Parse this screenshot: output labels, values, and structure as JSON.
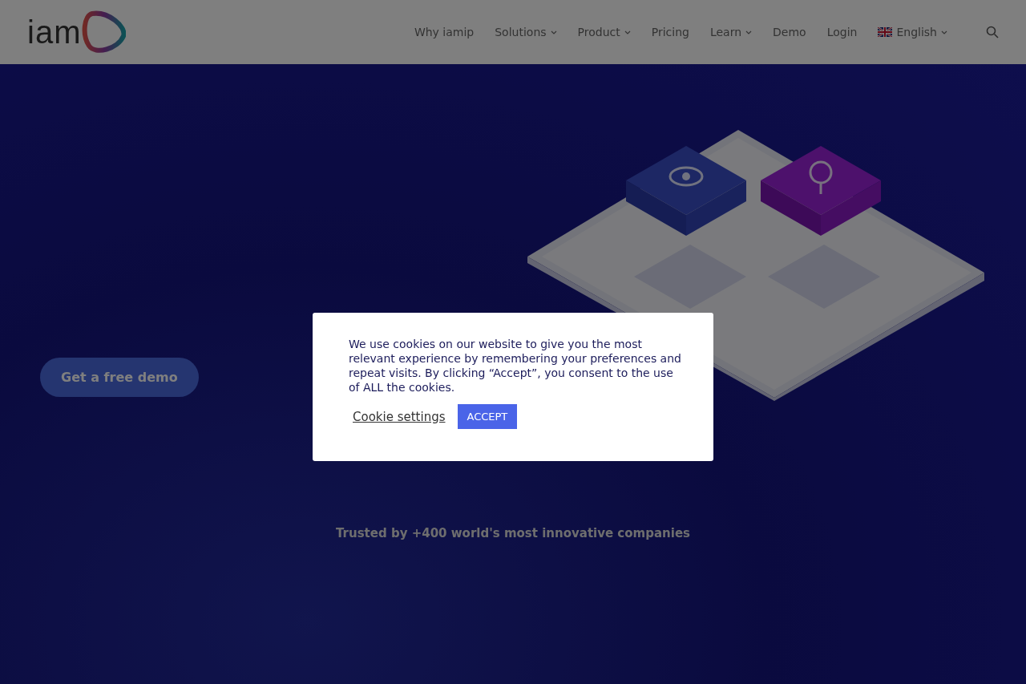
{
  "header": {
    "logo_text": "iam",
    "nav": [
      {
        "label": "Why iamip",
        "has_dropdown": false
      },
      {
        "label": "Solutions",
        "has_dropdown": true
      },
      {
        "label": "Product",
        "has_dropdown": true
      },
      {
        "label": "Pricing",
        "has_dropdown": false
      },
      {
        "label": "Learn",
        "has_dropdown": true
      },
      {
        "label": "Demo",
        "has_dropdown": false
      },
      {
        "label": "Login",
        "has_dropdown": false
      }
    ],
    "language": {
      "label": "English",
      "has_dropdown": true
    }
  },
  "hero": {
    "cta": "Get a free demo",
    "trusted": "Trusted by +400 world's most innovative companies"
  },
  "cookie_dialog": {
    "message": "We use cookies on our website to give you the most relevant experience by remembering your preferences and repeat visits. By clicking “Accept”, you consent to the use of ALL the cookies.",
    "settings_link": "Cookie settings",
    "accept": "ACCEPT"
  }
}
